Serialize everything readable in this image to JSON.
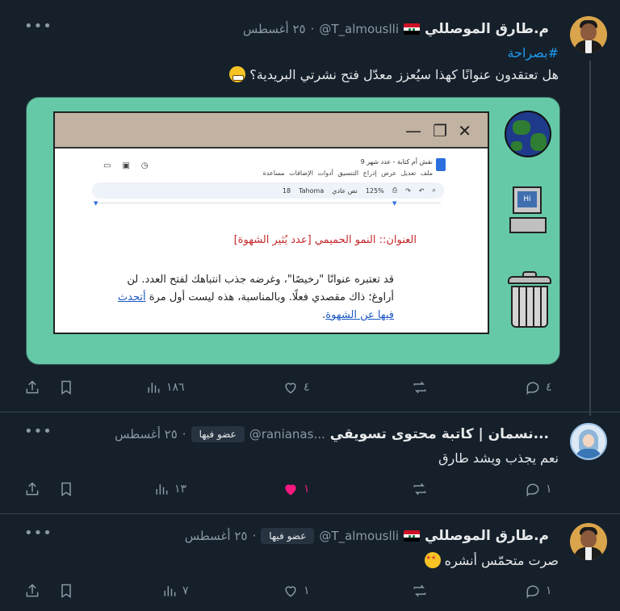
{
  "tweets": [
    {
      "name": "م.طارق الموصللي",
      "handle": "@T_almouslli",
      "dot": "·",
      "date": "٢٥ أغسطس",
      "hashtag": "#بصراحة",
      "text": "هل تعتقدون عنوانًا كهذا سيُعزز معدّل فتح نشرتي البريدية؟",
      "stats": {
        "replies": "٤",
        "retweets": "",
        "likes": "٤",
        "views": "١٨٦"
      }
    },
    {
      "name": "نسمان | كاتبة محتوى تسويقي...",
      "handle": "@ranianas...",
      "badge": "عضو فيها",
      "dot": "·",
      "date": "٢٥ أغسطس",
      "text": "نعم يجذب ويشد طارق",
      "stats": {
        "replies": "١",
        "retweets": "",
        "likes": "١",
        "views": "١٣"
      }
    },
    {
      "name": "م.طارق الموصللي",
      "handle": "@T_almouslli",
      "badge": "عضو فيها",
      "dot": "·",
      "date": "٢٥ أغسطس",
      "text": "صرت متحمّس أنشره",
      "stats": {
        "replies": "١",
        "retweets": "",
        "likes": "١",
        "views": "٧"
      }
    }
  ],
  "media": {
    "doc_title": "نقش أم كتابة - عدد شهر 9",
    "doc_menu": "ملف تعديل عرض إدراج التنسيق أدوات الإضافات مساعدة",
    "toolbar": {
      "zoom": "125%",
      "style": "نص عادي",
      "font": "Tahoma",
      "size": "18"
    },
    "heading": "العنوان:: النمو الحميمي  [عدد يُثير الشهوة]",
    "body": "قد تعتبره عنوانًا \"رخيصًا\"، وغرضه جذب انتباهك لفتح العدد. لن أراوغ؛ ذاك مقصدي فعلًا. وبالمناسبة، هذه ليست أول مرة",
    "link": "أتحدث فيها عن الشهوة",
    "link_end": ".",
    "screen_label": "Hi",
    "icons": [
      "globe-icon",
      "computer-icon",
      "trash-icon"
    ]
  },
  "colors": {
    "background": "#15202b",
    "accent": "#1d9bf0",
    "like_active": "#f91880",
    "media_bg": "#65c9a8"
  }
}
